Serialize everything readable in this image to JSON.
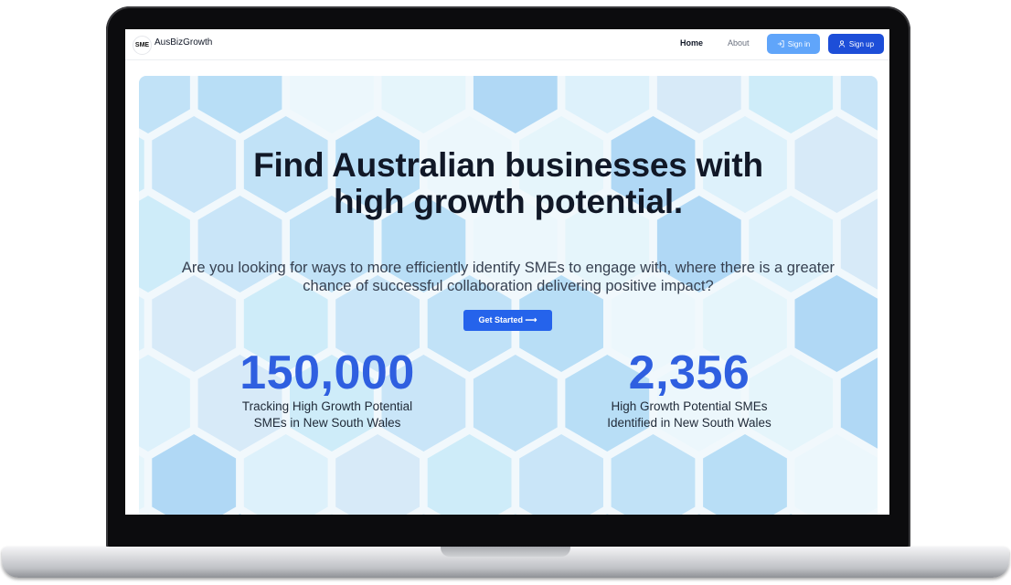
{
  "app": {
    "logo_text": "SME",
    "brand": "AusBizGrowth"
  },
  "nav": {
    "home": "Home",
    "about": "About",
    "sign_in": "Sign in",
    "sign_up": "Sign up"
  },
  "hero": {
    "title_line1": "Find Australian businesses with",
    "title_line2": "high growth potential.",
    "subtitle_line1": "Are you looking for ways to more efficiently identify SMEs to engage with, where there is a greater",
    "subtitle_line2": "chance of successful collaboration delivering positive impact?",
    "cta": "Get Started ⟶"
  },
  "stats": [
    {
      "value": "150,000",
      "label_line1": "Tracking High Growth Potential",
      "label_line2": "SMEs in New South Wales"
    },
    {
      "value": "2,356",
      "label_line1": "High Growth Potential SMEs",
      "label_line2": "Identified in New South Wales"
    }
  ],
  "colors": {
    "primary": "#2563eb",
    "primary_dark": "#1d4ed8",
    "primary_light": "#60a5fa",
    "stat_number": "#2f5fe0"
  }
}
